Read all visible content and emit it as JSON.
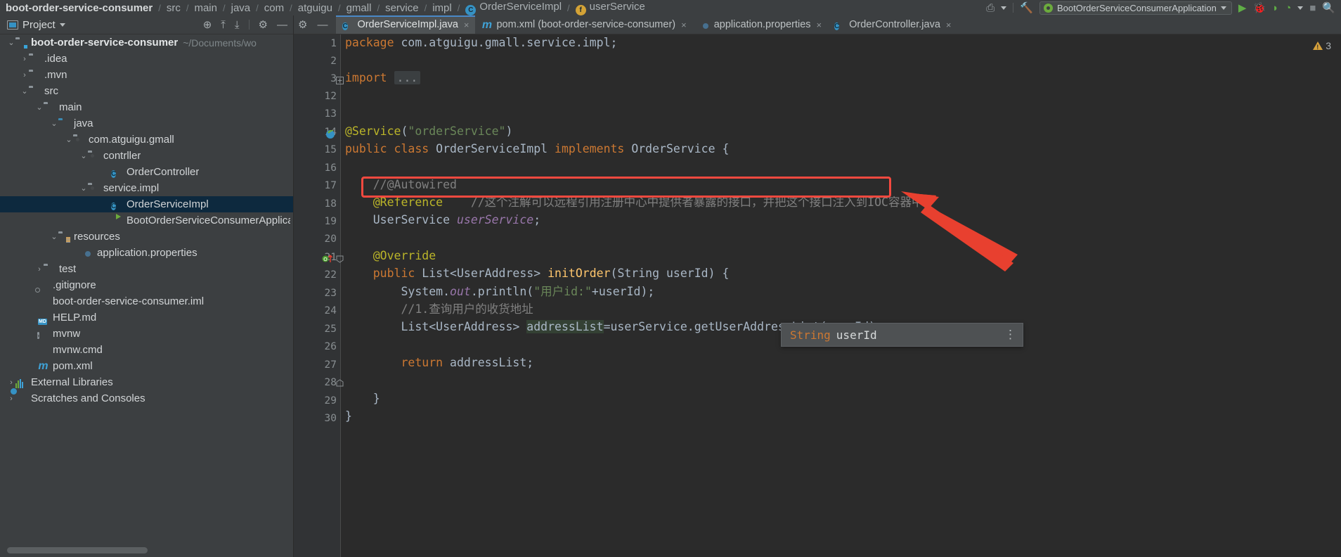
{
  "navbar": {
    "breadcrumbs": [
      {
        "label": "boot-order-service-consumer",
        "icon": "",
        "bold": true
      },
      {
        "label": "src",
        "icon": ""
      },
      {
        "label": "main",
        "icon": ""
      },
      {
        "label": "java",
        "icon": ""
      },
      {
        "label": "com",
        "icon": ""
      },
      {
        "label": "atguigu",
        "icon": ""
      },
      {
        "label": "gmall",
        "icon": ""
      },
      {
        "label": "service",
        "icon": ""
      },
      {
        "label": "impl",
        "icon": ""
      },
      {
        "label": "OrderServiceImpl",
        "icon": "class-icon"
      },
      {
        "label": "userService",
        "icon": "field-icon"
      }
    ],
    "run_configuration": "BootOrderServiceConsumerApplication",
    "buttons": {
      "run": "run-button",
      "debug": "debug-button",
      "coverage": "run-with-coverage-button",
      "profile": "profile-button",
      "stop": "stop-button",
      "search": "search-button"
    }
  },
  "sidebar": {
    "title": "Project",
    "actions": [
      "locate-icon",
      "expand-all-icon",
      "collapse-all-icon",
      "settings-icon",
      "minimize-icon"
    ],
    "tree": [
      {
        "label": "boot-order-service-consumer",
        "sub": "~/Documents/wo",
        "depth": 0,
        "arrow": "v",
        "icon": "module-folder",
        "bold": true
      },
      {
        "label": ".idea",
        "depth": 1,
        "arrow": ">",
        "icon": "folder"
      },
      {
        "label": ".mvn",
        "depth": 1,
        "arrow": ">",
        "icon": "folder"
      },
      {
        "label": "src",
        "depth": 1,
        "arrow": "v",
        "icon": "folder"
      },
      {
        "label": "main",
        "depth": 2,
        "arrow": "v",
        "icon": "folder"
      },
      {
        "label": "java",
        "depth": 3,
        "arrow": "v",
        "icon": "source-folder"
      },
      {
        "label": "com.atguigu.gmall",
        "depth": 4,
        "arrow": "v",
        "icon": "package"
      },
      {
        "label": "contrller",
        "depth": 5,
        "arrow": "v",
        "icon": "package"
      },
      {
        "label": "OrderController",
        "depth": 6,
        "arrow": "",
        "icon": "java-class"
      },
      {
        "label": "service.impl",
        "depth": 5,
        "arrow": "v",
        "icon": "package"
      },
      {
        "label": "OrderServiceImpl",
        "depth": 6,
        "arrow": "",
        "icon": "java-class",
        "selected": true
      },
      {
        "label": "BootOrderServiceConsumerApplicat",
        "depth": 6,
        "arrow": "",
        "icon": "spring-boot-class"
      },
      {
        "label": "resources",
        "depth": 3,
        "arrow": "v",
        "icon": "resources-folder"
      },
      {
        "label": "application.properties",
        "depth": 4,
        "arrow": "",
        "icon": "spring-properties"
      },
      {
        "label": "test",
        "depth": 2,
        "arrow": ">",
        "icon": "folder"
      },
      {
        "label": ".gitignore",
        "depth": 1,
        "arrow": "",
        "icon": "gitignore-file"
      },
      {
        "label": "boot-order-service-consumer.iml",
        "depth": 1,
        "arrow": "",
        "icon": "iml-file"
      },
      {
        "label": "HELP.md",
        "depth": 1,
        "arrow": "",
        "icon": "markdown-file"
      },
      {
        "label": "mvnw",
        "depth": 1,
        "arrow": "",
        "icon": "shell-file"
      },
      {
        "label": "mvnw.cmd",
        "depth": 1,
        "arrow": "",
        "icon": "cmd-file"
      },
      {
        "label": "pom.xml",
        "depth": 1,
        "arrow": "",
        "icon": "maven-file"
      },
      {
        "label": "External Libraries",
        "depth": 0,
        "arrow": ">",
        "icon": "libraries"
      },
      {
        "label": "Scratches and Consoles",
        "depth": 0,
        "arrow": ">",
        "icon": "scratches"
      }
    ]
  },
  "tabs": [
    {
      "label": "OrderServiceImpl.java",
      "icon": "java-class",
      "active": true,
      "close": "×"
    },
    {
      "label": "pom.xml (boot-order-service-consumer)",
      "icon": "maven-file",
      "active": false,
      "close": "×"
    },
    {
      "label": "application.properties",
      "icon": "spring-properties",
      "active": false,
      "close": "×"
    },
    {
      "label": "OrderController.java",
      "icon": "java-class",
      "active": false,
      "close": "×"
    }
  ],
  "editor": {
    "inspection_count": "3",
    "line_numbers": [
      "1",
      "2",
      "3",
      "12",
      "13",
      "14",
      "15",
      "16",
      "17",
      "18",
      "19",
      "20",
      "21",
      "22",
      "23",
      "24",
      "25",
      "26",
      "27",
      "28",
      "29",
      "30"
    ],
    "lines": [
      {
        "n": "1",
        "segments": [
          {
            "t": "package ",
            "c": "k"
          },
          {
            "t": "com.atguigu.gmall.service.impl;",
            "c": "pl"
          }
        ]
      },
      {
        "n": "2",
        "segments": []
      },
      {
        "n": "3",
        "segments": [
          {
            "t": "import ",
            "c": "k"
          },
          {
            "t": "...",
            "c": "fold-box"
          }
        ]
      },
      {
        "n": "12",
        "segments": []
      },
      {
        "n": "13",
        "segments": [
          {
            "t": "@Service",
            "c": "an"
          },
          {
            "t": "(",
            "c": "pl"
          },
          {
            "t": "\"orderService\"",
            "c": "st"
          },
          {
            "t": ")",
            "c": "pl"
          }
        ]
      },
      {
        "n": "14",
        "segments": [
          {
            "t": "public class ",
            "c": "k"
          },
          {
            "t": "OrderServiceImpl ",
            "c": "pl"
          },
          {
            "t": "implements ",
            "c": "k"
          },
          {
            "t": "OrderService {",
            "c": "pl"
          }
        ]
      },
      {
        "n": "15",
        "segments": []
      },
      {
        "n": "16",
        "segments": [
          {
            "t": "    //@Autowired",
            "c": "cm"
          }
        ]
      },
      {
        "n": "17",
        "segments": [
          {
            "t": "    @Reference",
            "c": "an"
          },
          {
            "t": "    //这个注解可以远程引用注册中心中提供者暴露的接口，并把这个接口注入到IOC容器中",
            "c": "cm"
          }
        ]
      },
      {
        "n": "18",
        "segments": [
          {
            "t": "    UserService ",
            "c": "pl"
          },
          {
            "t": "userService",
            "c": "fld"
          },
          {
            "t": ";",
            "c": "pl"
          }
        ]
      },
      {
        "n": "19",
        "segments": []
      },
      {
        "n": "20",
        "segments": [
          {
            "t": "    @Override",
            "c": "an"
          }
        ]
      },
      {
        "n": "21",
        "segments": [
          {
            "t": "    public ",
            "c": "k"
          },
          {
            "t": "List<UserAddress> ",
            "c": "pl"
          },
          {
            "t": "initOrder",
            "c": "fn"
          },
          {
            "t": "(",
            "c": "pl"
          },
          {
            "t": "String ",
            "c": "pl"
          },
          {
            "t": "userId) {",
            "c": "pl"
          }
        ]
      },
      {
        "n": "22",
        "segments": [
          {
            "t": "        System.",
            "c": "pl"
          },
          {
            "t": "out",
            "c": "fld"
          },
          {
            "t": ".println(",
            "c": "pl"
          },
          {
            "t": "\"用户id:\"",
            "c": "st"
          },
          {
            "t": "+userId);",
            "c": "pl"
          }
        ]
      },
      {
        "n": "23",
        "segments": [
          {
            "t": "        //1.查询用户的收货地址",
            "c": "cm"
          }
        ]
      },
      {
        "n": "24",
        "segments": [
          {
            "t": "        List<UserAddress> ",
            "c": "pl"
          },
          {
            "t": "addressList",
            "c": "hl-ident"
          },
          {
            "t": "=userService.getUserAddressList(userId);",
            "c": "pl"
          }
        ]
      },
      {
        "n": "25",
        "segments": []
      },
      {
        "n": "26",
        "segments": [
          {
            "t": "        return ",
            "c": "k"
          },
          {
            "t": "addressList;",
            "c": "pl"
          }
        ]
      },
      {
        "n": "27",
        "segments": []
      },
      {
        "n": "28",
        "segments": [
          {
            "t": "    }",
            "c": "pl"
          }
        ]
      },
      {
        "n": "29",
        "segments": [
          {
            "t": "}",
            "c": "pl"
          }
        ]
      },
      {
        "n": "30",
        "segments": []
      }
    ],
    "gutter_icons": [
      {
        "line": "14",
        "name": "spring-bean-gutter-icon"
      },
      {
        "line": "21",
        "name": "overriding-method-gutter-icon"
      }
    ],
    "param_tooltip": {
      "type": "String",
      "name": "userId",
      "more": "more-options-icon"
    }
  },
  "annotations": {
    "highlight_box_color": "#f4493f",
    "arrow_color": "#e8402f",
    "arrow_name": "red-pointer-arrow"
  }
}
